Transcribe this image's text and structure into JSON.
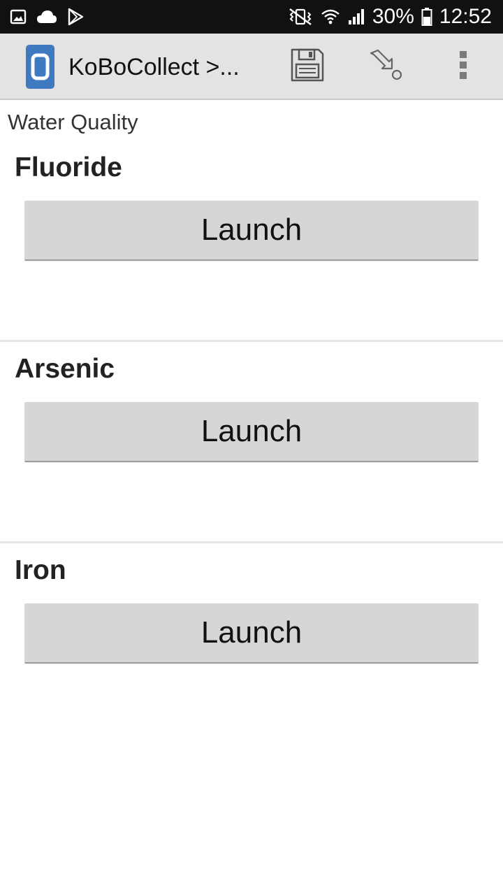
{
  "status_bar": {
    "battery_percent": "30%",
    "time": "12:52",
    "icons_left": [
      "image-icon",
      "cloud-icon",
      "play-store-icon"
    ],
    "icons_right": [
      "vibrate-mute-icon",
      "wifi-icon",
      "signal-icon",
      "battery-icon"
    ]
  },
  "action_bar": {
    "title": "KoBoCollect >...",
    "actions": [
      "save-icon",
      "go-to-icon",
      "overflow-menu-icon"
    ]
  },
  "form": {
    "group_title": "Water Quality",
    "questions": [
      {
        "label": "Fluoride",
        "button_label": "Launch"
      },
      {
        "label": "Arsenic",
        "button_label": "Launch"
      },
      {
        "label": "Iron",
        "button_label": "Launch"
      }
    ]
  },
  "colors": {
    "status_bar_bg": "#111111",
    "action_bar_bg": "#e3e3e3",
    "app_icon_blue": "#3f7ac0",
    "button_bg": "#d6d6d6",
    "divider": "#e6e6e6"
  }
}
